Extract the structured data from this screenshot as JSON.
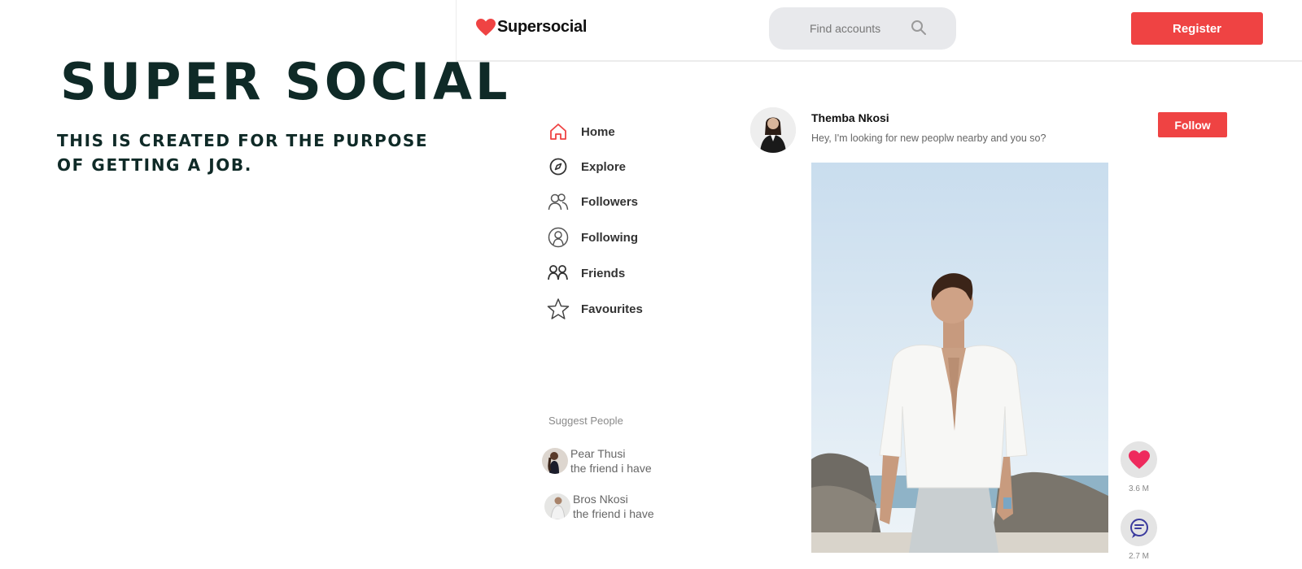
{
  "hero": {
    "title": "SUPER SOCIAL",
    "subtitle": "THIS IS CREATED FOR THE PURPOSE OF GETTING A JOB."
  },
  "header": {
    "brand": "Supersocial",
    "search_placeholder": "Find accounts",
    "register_label": "Register"
  },
  "colors": {
    "accent": "#ef4343",
    "hero_text": "#0f2a27"
  },
  "nav": {
    "items": [
      {
        "label": "Home",
        "icon": "home-icon"
      },
      {
        "label": "Explore",
        "icon": "compass-icon"
      },
      {
        "label": "Followers",
        "icon": "followers-icon"
      },
      {
        "label": "Following",
        "icon": "following-icon"
      },
      {
        "label": "Friends",
        "icon": "friends-icon"
      },
      {
        "label": "Favourites",
        "icon": "star-icon"
      }
    ]
  },
  "suggest": {
    "title": "Suggest People",
    "people": [
      {
        "name": "Pear Thusi",
        "note": "the friend i have"
      },
      {
        "name": "Bros Nkosi",
        "note": "the friend i have"
      }
    ]
  },
  "post": {
    "author": "Themba Nkosi",
    "text": "Hey, I'm looking for new peoplw nearby and you so?",
    "follow_label": "Follow",
    "likes": "3.6 M",
    "comments": "2.7 M"
  }
}
